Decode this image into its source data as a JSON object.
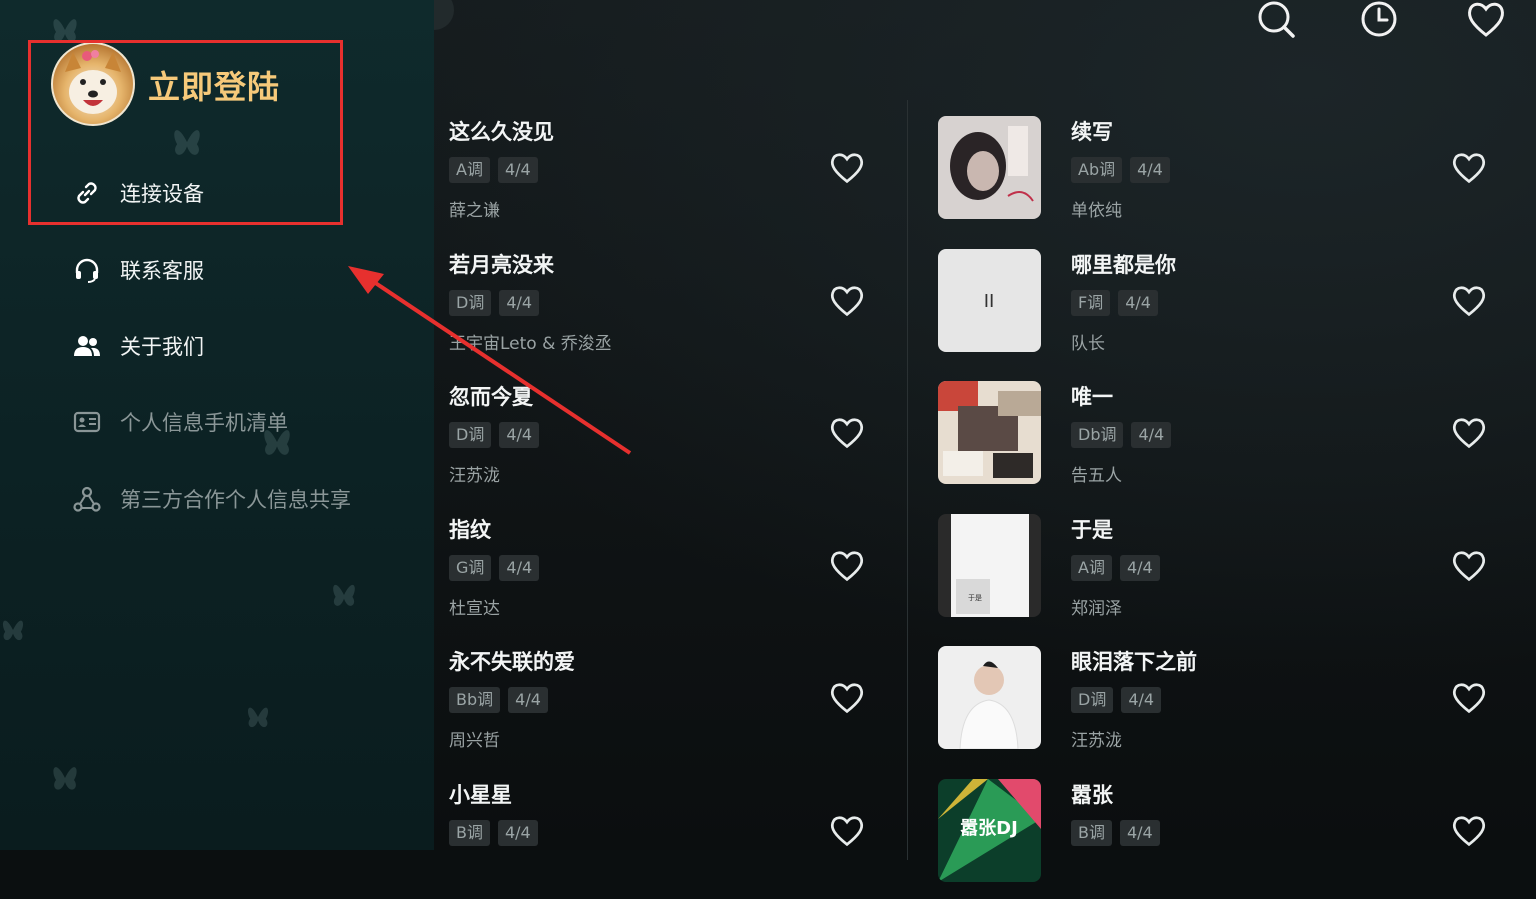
{
  "drawer": {
    "login_label": "立即登陆",
    "menu": [
      {
        "label": "连接设备",
        "icon": "link-icon",
        "dim": false
      },
      {
        "label": "联系客服",
        "icon": "headset-icon",
        "dim": false
      },
      {
        "label": "关于我们",
        "icon": "users-icon",
        "dim": false
      },
      {
        "label": "个人信息手机清单",
        "icon": "id-card-icon",
        "dim": true
      },
      {
        "label": "第三方合作个人信息共享",
        "icon": "share-icon",
        "dim": true
      }
    ]
  },
  "toolbar": {
    "icons": [
      "search-icon",
      "history-icon",
      "heart-icon"
    ]
  },
  "songs_left": [
    {
      "title": "这么久没见",
      "key": "A调",
      "meter": "4/4",
      "artist": "薛之谦"
    },
    {
      "title": "若月亮没来",
      "key": "D调",
      "meter": "4/4",
      "artist": "王宇宙Leto & 乔浚丞"
    },
    {
      "title": "忽而今夏",
      "key": "D调",
      "meter": "4/4",
      "artist": "汪苏泷"
    },
    {
      "title": "指纹",
      "key": "G调",
      "meter": "4/4",
      "artist": "杜宣达"
    },
    {
      "title": "永不失联的爱",
      "key": "Bb调",
      "meter": "4/4",
      "artist": "周兴哲"
    },
    {
      "title": "小星星",
      "key": "B调",
      "meter": "4/4",
      "artist": ""
    }
  ],
  "songs_right": [
    {
      "title": "续写",
      "key": "Ab调",
      "meter": "4/4",
      "artist": "单依纯",
      "cover": "dark-portrait",
      "cover_text": ""
    },
    {
      "title": "哪里都是你",
      "key": "F调",
      "meter": "4/4",
      "artist": "队长",
      "cover": "grey",
      "cover_text": "II"
    },
    {
      "title": "唯一",
      "key": "Db调",
      "meter": "4/4",
      "artist": "告五人",
      "cover": "collage",
      "cover_text": ""
    },
    {
      "title": "于是",
      "key": "A调",
      "meter": "4/4",
      "artist": "郑润泽",
      "cover": "white-card",
      "cover_text": "于是"
    },
    {
      "title": "眼泪落下之前",
      "key": "D调",
      "meter": "4/4",
      "artist": "汪苏泷",
      "cover": "white-suit",
      "cover_text": ""
    },
    {
      "title": "嚣张",
      "key": "B调",
      "meter": "4/4",
      "artist": "",
      "cover": "green-dj",
      "cover_text": "嚣张DJ"
    }
  ],
  "colors": {
    "accent": "#f6c97a",
    "highlight_box": "#e7302e",
    "background": "#0b0f10",
    "drawer": "#0f2a2c"
  }
}
